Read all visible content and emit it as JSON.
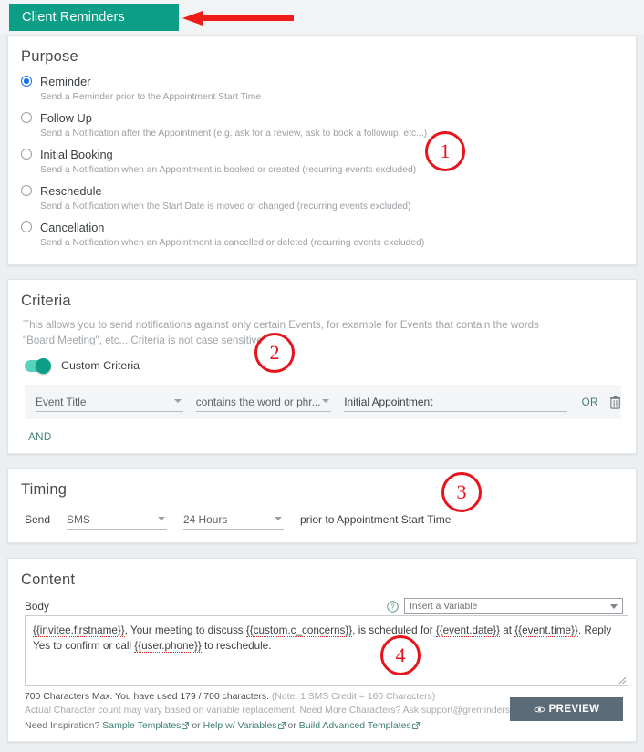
{
  "header": {
    "tab_label": "Client Reminders",
    "arrow_annotation": "red-left-arrow",
    "accent_color": "#0d9e87"
  },
  "purpose": {
    "title": "Purpose",
    "selected": "Reminder",
    "options": [
      {
        "label": "Reminder",
        "desc": "Send a Reminder prior to the Appointment Start Time",
        "checked": true
      },
      {
        "label": "Follow Up",
        "desc": "Send a Notification after the Appointment (e.g. ask for a review, ask to book a followup, etc...)",
        "checked": false
      },
      {
        "label": "Initial Booking",
        "desc": "Send a Notification when an Appointment is booked or created (recurring events excluded)",
        "checked": false
      },
      {
        "label": "Reschedule",
        "desc": "Send a Notification when the Start Date is moved or changed (recurring events excluded)",
        "checked": false
      },
      {
        "label": "Cancellation",
        "desc": "Send a Notification when an Appointment is cancelled or deleted (recurring events excluded)",
        "checked": false
      }
    ]
  },
  "criteria": {
    "title": "Criteria",
    "description": "This allows you to send notifications against only certain Events, for example for Events that contain the words \"Board Meeting\", etc... Criteria is not case sensitive",
    "toggle_label": "Custom Criteria",
    "toggle_on": true,
    "row": {
      "field": "Event Title",
      "operator": "contains the word or phr...",
      "value": "Initial Appointment",
      "or_label": "OR",
      "delete_icon": "trash-icon"
    },
    "and_label": "AND"
  },
  "timing": {
    "title": "Timing",
    "send_label": "Send",
    "method": "SMS",
    "lead_time": "24 Hours",
    "suffix": "prior to Appointment Start Time"
  },
  "content": {
    "title": "Content",
    "body_label": "Body",
    "help_icon": "question-mark-icon",
    "variable_select_placeholder": "Insert a Variable",
    "body_text": "{{invitee.firstname}}, Your meeting to discuss {{custom.c_concerns}}, is scheduled for {{event.date}} at {{event.time}}. Reply Yes to confirm or call {{user.phone}} to reschedule.",
    "char_count_strong": "700 Characters Max. You have used 179 / 700 characters.",
    "char_count_note": "(Note: 1 SMS Credit = 160 Characters)",
    "char_count_line2": "Actual Character count may vary based on variable replacement. Need More Characters? Ask support@greminders.com",
    "links_prefix": "Need Inspiration?",
    "link1": "Sample Templates",
    "link_sep1": "or",
    "link2": "Help w/ Variables",
    "link_sep2": "or",
    "link3": "Build Advanced Templates",
    "preview_button": "PREVIEW",
    "characters_used": 179,
    "characters_max": 700
  },
  "annotations": {
    "one": "1",
    "two": "2",
    "three": "3",
    "four": "4",
    "color": "#e8141c"
  }
}
